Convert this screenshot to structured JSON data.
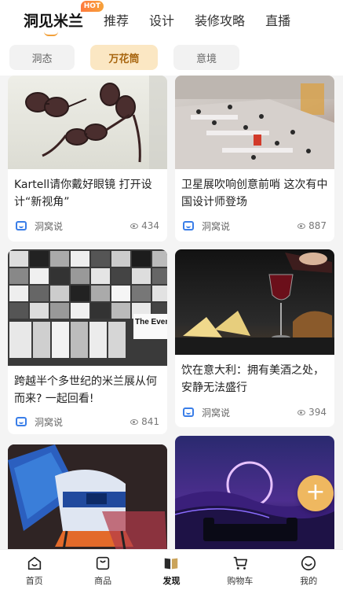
{
  "top_tabs": [
    {
      "label": "洞见米兰",
      "badge": "HOT"
    },
    {
      "label": "推荐"
    },
    {
      "label": "设计"
    },
    {
      "label": "装修攻略"
    },
    {
      "label": "直播"
    }
  ],
  "sub_tabs": [
    {
      "label": "洞态"
    },
    {
      "label": "万花筒"
    },
    {
      "label": "意境"
    }
  ],
  "cards": [
    {
      "title": "Kartell请你戴好眼镜 打开设计“新视角”",
      "author": "洞窝说",
      "views": "434"
    },
    {
      "title": "卫星展吹响创意前哨 这次有中国设计师登场",
      "author": "洞窝说",
      "views": "887"
    },
    {
      "title": "跨越半个多世纪的米兰展从何而来? 一起回看!",
      "author": "洞窝说",
      "views": "841",
      "image_text": "The Event"
    },
    {
      "title": "饮在意大利：拥有美酒之处，安静无法盛行",
      "author": "洞窝说",
      "views": "394"
    },
    {
      "title": "",
      "author": "",
      "views": ""
    },
    {
      "title": "",
      "author": "",
      "views": ""
    }
  ],
  "fab": {
    "label": "+"
  },
  "bottom_nav": [
    {
      "label": "首页",
      "icon": "home-smile-icon"
    },
    {
      "label": "商品",
      "icon": "bag-icon"
    },
    {
      "label": "发现",
      "icon": "discover-book-icon",
      "active": true
    },
    {
      "label": "购物车",
      "icon": "cart-icon"
    },
    {
      "label": "我的",
      "icon": "profile-smile-icon"
    }
  ],
  "colors": {
    "accent": "#efb860",
    "chip_active_bg": "#fbe7c3",
    "chip_active_text": "#a8660f",
    "hot_badge": "#ff7a3d",
    "author_icon": "#3a7ee8"
  }
}
